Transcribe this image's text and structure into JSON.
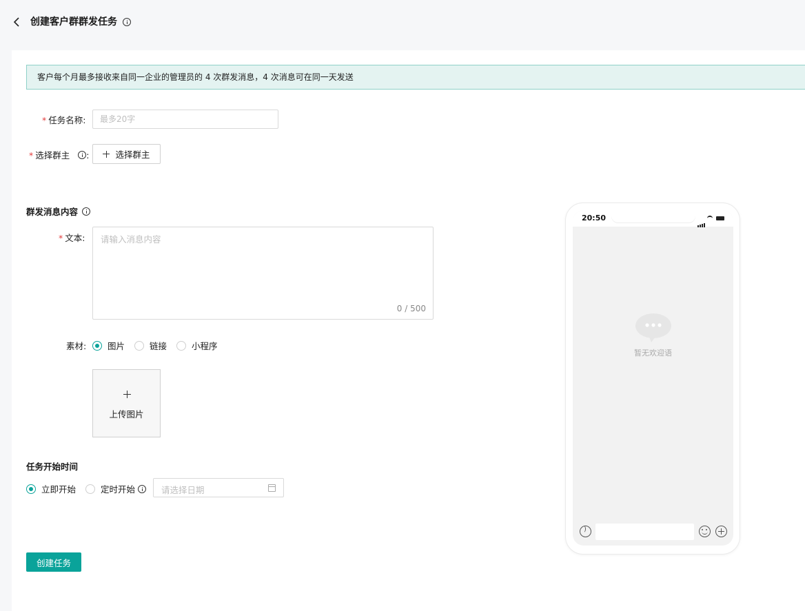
{
  "header": {
    "title": "创建客户群群发任务"
  },
  "notice": "客户每个月最多接收来自同一企业的管理员的 4 次群发消息，4 次消息可在同一天发送",
  "form": {
    "task_name": {
      "label": "任务名称:",
      "placeholder": "最多20字",
      "required_mark": "*"
    },
    "group_owner": {
      "label": "选择群主",
      "colon": ":",
      "button_label": "选择群主",
      "required_mark": "*"
    },
    "message_section": {
      "title": "群发消息内容",
      "text": {
        "label": "文本:",
        "placeholder": "请输入消息内容",
        "counter": "0 / 500",
        "required_mark": "*"
      },
      "material": {
        "label": "素材:",
        "options": [
          {
            "label": "图片",
            "checked": true
          },
          {
            "label": "链接",
            "checked": false
          },
          {
            "label": "小程序",
            "checked": false
          }
        ],
        "upload_label": "上传图片"
      }
    },
    "start_section": {
      "title": "任务开始时间",
      "options": [
        {
          "label": "立即开始",
          "checked": true
        },
        {
          "label": "定时开始",
          "checked": false
        }
      ],
      "date_placeholder": "请选择日期"
    },
    "submit_label": "创建任务"
  },
  "preview": {
    "time": "20:50",
    "empty_text": "暂无欢迎语"
  },
  "colors": {
    "accent": "#0aa39a",
    "notice_bg": "#e4f3f1",
    "required": "#e23b3b"
  }
}
